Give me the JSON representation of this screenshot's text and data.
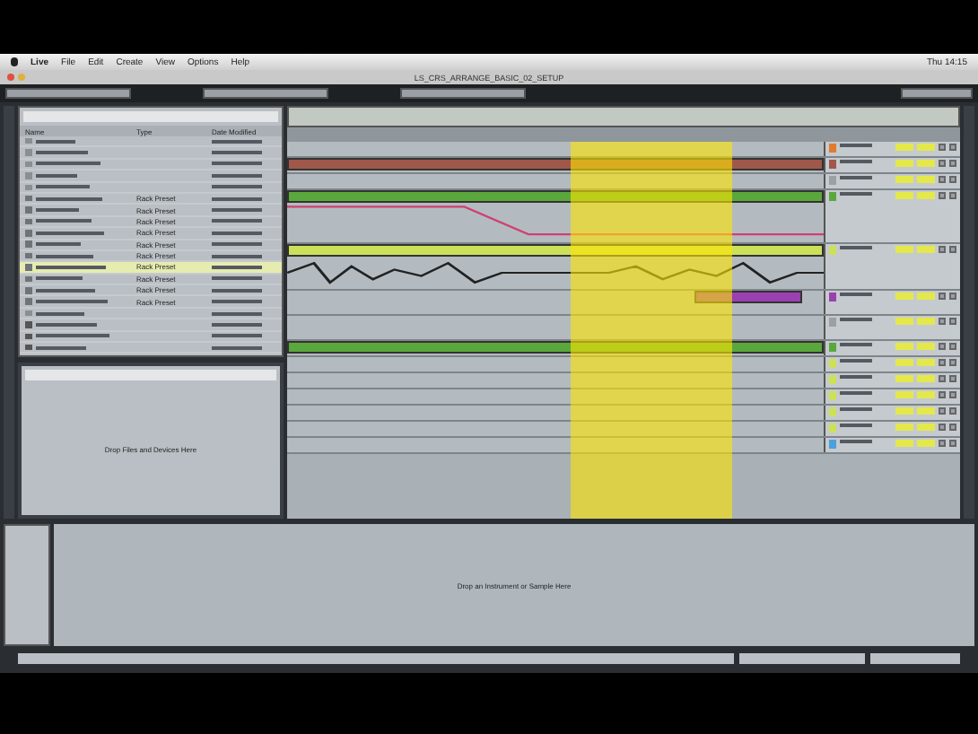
{
  "menu_bar": {
    "items": [
      "Live",
      "File",
      "Edit",
      "Create",
      "View",
      "Options",
      "Help"
    ],
    "clock": "Thu 14:15"
  },
  "window": {
    "title": "LS_CRS_ARRANGE_BASIC_02_SETUP"
  },
  "browser": {
    "columns": [
      "Name",
      "Type",
      "Date Modified"
    ],
    "rows": [
      {
        "kind": "folder",
        "selected": false
      },
      {
        "kind": "folder",
        "selected": false
      },
      {
        "kind": "folder",
        "selected": false
      },
      {
        "kind": "folder",
        "selected": false
      },
      {
        "kind": "folder",
        "selected": false
      },
      {
        "kind": "preset",
        "selected": false,
        "type": "Rack Preset"
      },
      {
        "kind": "preset",
        "selected": false,
        "type": "Rack Preset"
      },
      {
        "kind": "preset",
        "selected": false,
        "type": "Rack Preset"
      },
      {
        "kind": "preset",
        "selected": false,
        "type": "Rack Preset"
      },
      {
        "kind": "preset",
        "selected": false,
        "type": "Rack Preset"
      },
      {
        "kind": "preset",
        "selected": false,
        "type": "Rack Preset"
      },
      {
        "kind": "preset",
        "selected": true,
        "type": "Rack Preset"
      },
      {
        "kind": "preset",
        "selected": false,
        "type": "Rack Preset"
      },
      {
        "kind": "preset",
        "selected": false,
        "type": "Rack Preset"
      },
      {
        "kind": "preset",
        "selected": false,
        "type": "Rack Preset"
      },
      {
        "kind": "folder",
        "selected": false
      },
      {
        "kind": "device",
        "selected": false
      },
      {
        "kind": "device",
        "selected": false
      },
      {
        "kind": "device",
        "selected": false
      }
    ]
  },
  "clip_panel": {
    "message": "Drop Files and Devices Here"
  },
  "tracks": [
    {
      "kind": "compact",
      "color": "#e07a30",
      "clip": false
    },
    {
      "kind": "compact",
      "color": "#a0584a",
      "clip": true
    },
    {
      "kind": "compact",
      "color": "#9aa0a4",
      "clip": false
    },
    {
      "kind": "automation",
      "color": "#5aa83c",
      "clip": true
    },
    {
      "kind": "audio",
      "color": "#cde05a",
      "clip": true
    },
    {
      "kind": "tall",
      "color": "#9a40b0",
      "clip": true
    },
    {
      "kind": "tall",
      "color": "#9aa0a4",
      "clip": false
    },
    {
      "kind": "compact",
      "color": "#5aa83c",
      "clip": true
    },
    {
      "kind": "compact",
      "color": "#cde05a",
      "clip": false
    },
    {
      "kind": "compact",
      "color": "#cde05a",
      "clip": false
    },
    {
      "kind": "compact",
      "color": "#cde05a",
      "clip": false
    },
    {
      "kind": "compact",
      "color": "#cde05a",
      "clip": false
    },
    {
      "kind": "compact",
      "color": "#cde05a",
      "clip": false
    },
    {
      "kind": "compact",
      "color": "#4aa0e0",
      "clip": false
    }
  ],
  "detail": {
    "message": "Drop an Instrument or Sample Here"
  }
}
